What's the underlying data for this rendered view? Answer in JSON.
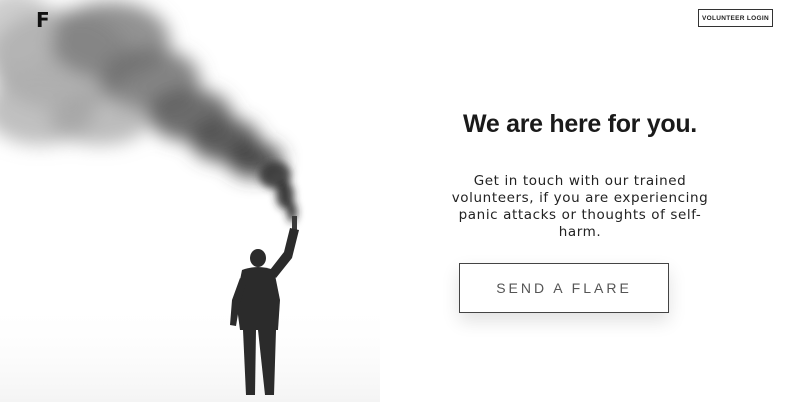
{
  "header": {
    "logo_text": "F",
    "volunteer_login_label": "VOLUNTEER LOGIN"
  },
  "hero": {
    "image_icon": "person-holding-smoke-flare-photo"
  },
  "main": {
    "headline": "We are here for you.",
    "description": "Get in touch with our trained volunteers, if you are experiencing panic attacks or thoughts of self-harm.",
    "cta_label": "SEND A FLARE"
  },
  "colors": {
    "background": "#ffffff",
    "text": "#1a1a1a",
    "button_border": "#444444"
  }
}
